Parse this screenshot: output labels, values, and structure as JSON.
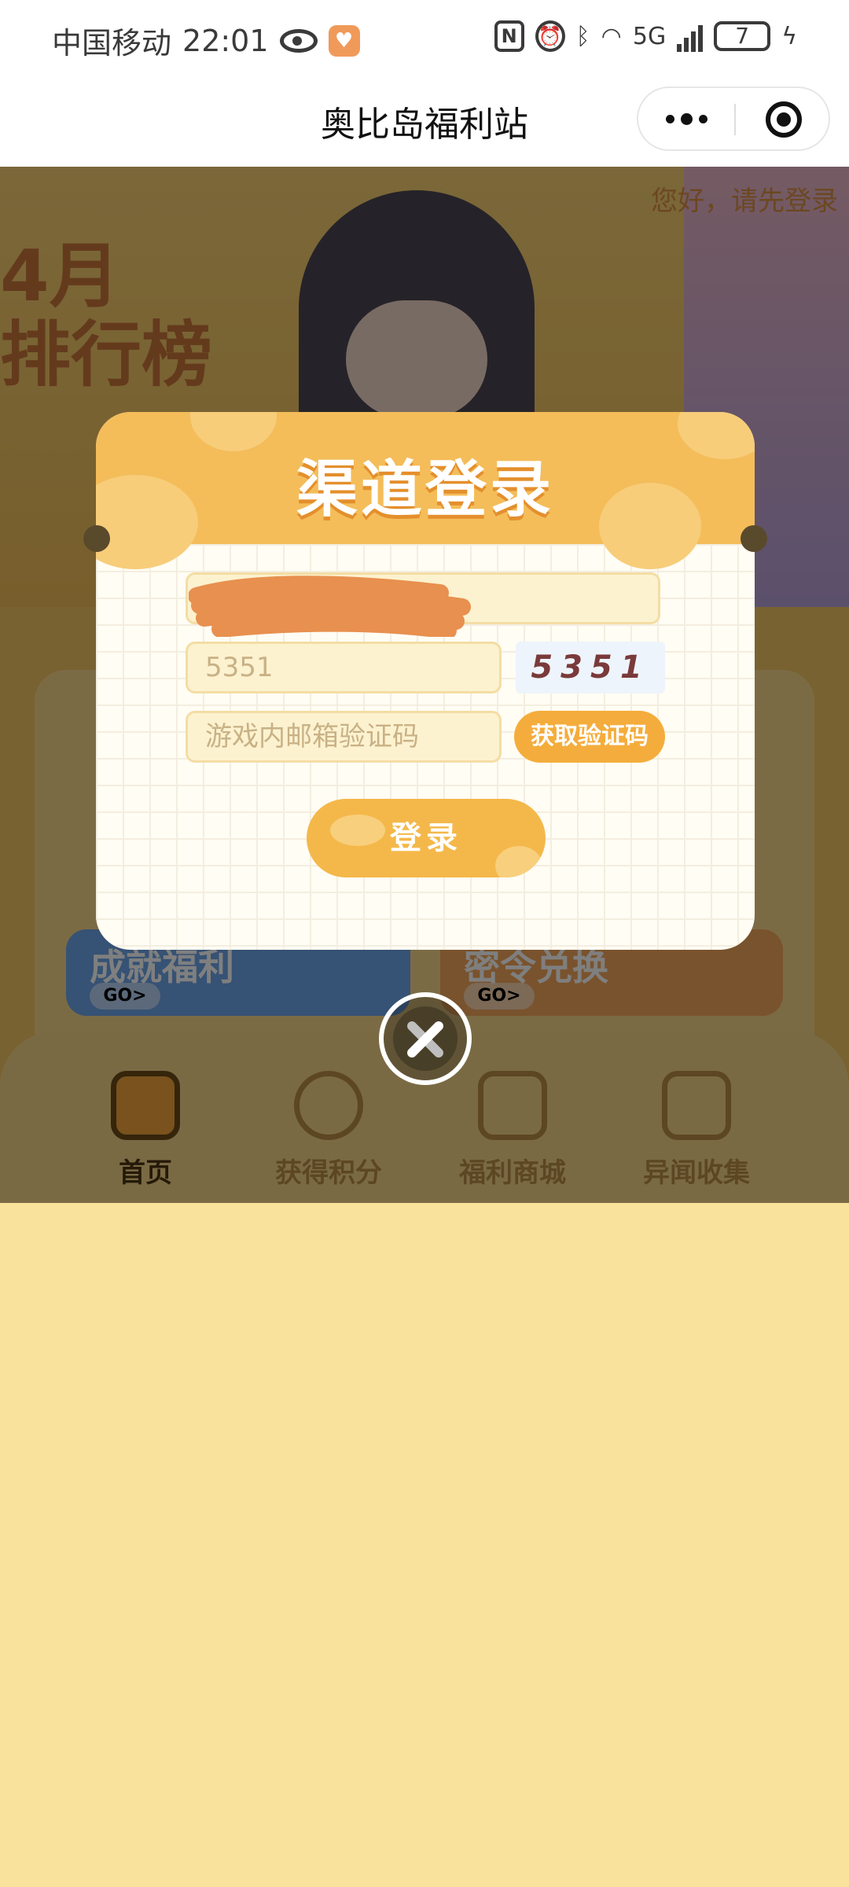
{
  "status_bar": {
    "carrier": "中国移动",
    "time": "22:01",
    "network": "5G",
    "battery": "7"
  },
  "nav": {
    "title": "奥比岛福利站"
  },
  "background": {
    "banner_text": "4月\n排行榜",
    "greeting": "您好，请先登录",
    "tiles": [
      {
        "label": "成就福利",
        "go": "GO>"
      },
      {
        "label": "密令兑换",
        "go": "GO>"
      }
    ],
    "tabs": [
      {
        "label": "首页",
        "active": true
      },
      {
        "label": "获得积分",
        "active": false
      },
      {
        "label": "福利商城",
        "active": false
      },
      {
        "label": "异闻收集",
        "active": false
      }
    ]
  },
  "modal": {
    "title": "渠道登录",
    "captcha_value": "5351",
    "captcha_image_text": "5351",
    "mail_code_placeholder": "游戏内邮箱验证码",
    "get_code_label": "获取验证码",
    "login_label": "登录"
  },
  "colors": {
    "accent": "#f4ad3c",
    "page_background": "#f9e29b",
    "redaction": "#e8904f"
  }
}
